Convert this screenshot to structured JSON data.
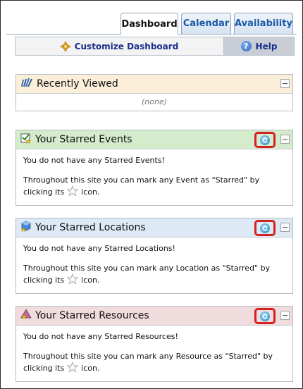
{
  "tabs": [
    {
      "label": "Dashboard",
      "active": true
    },
    {
      "label": "Calendar",
      "active": false
    },
    {
      "label": "Availability",
      "active": false
    }
  ],
  "toolbar": {
    "customize_label": "Customize Dashboard",
    "customize_icon": "gear-icon",
    "help_label": "Help",
    "help_icon": "help-icon"
  },
  "panels": {
    "recent": {
      "title": "Recently Viewed",
      "icon": "recently-viewed-icon",
      "empty_text": "(none)",
      "header_color": "#fbefd9"
    },
    "events": {
      "title": "Your Starred Events",
      "icon": "starred-events-icon",
      "line1": "You do not have any Starred Events!",
      "line2_pre": "Throughout this site you can mark any Event as \"Starred\" by clicking its",
      "line2_post": "icon.",
      "header_color": "#d4ebcc"
    },
    "locations": {
      "title": "Your Starred Locations",
      "icon": "starred-locations-icon",
      "line1": "You do not have any Starred Locations!",
      "line2_pre": "Throughout this site you can mark any Location as \"Starred\" by clicking its",
      "line2_post": "icon.",
      "header_color": "#dde9f4"
    },
    "resources": {
      "title": "Your Starred Resources",
      "icon": "starred-resources-icon",
      "line1": "You do not have any Starred Resources!",
      "line2_pre": "Throughout this site you can mark any Resource as \"Starred\" by clicking its",
      "line2_post": "icon.",
      "header_color": "#f1dcdd"
    }
  },
  "colors": {
    "highlight_border": "#d42020",
    "tab_link": "#1c5aa6",
    "toolbar_link": "#1a2f8a"
  }
}
